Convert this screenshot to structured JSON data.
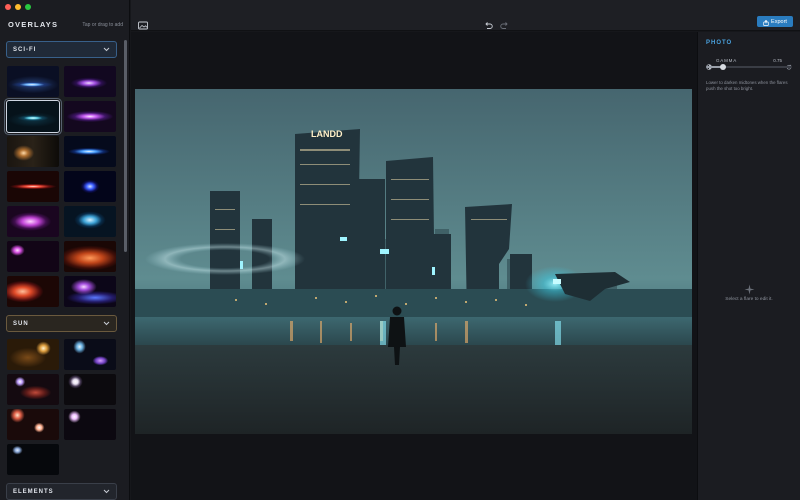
{
  "window": {
    "traffic_lights": [
      "#ff5f57",
      "#febc2e",
      "#28c840"
    ]
  },
  "sidebar": {
    "title": "OVERLAYS",
    "hint": "Tap or drag to add",
    "categories": [
      {
        "label": "SCI-FI",
        "expanded": true
      },
      {
        "label": "SUN",
        "expanded": true
      },
      {
        "label": "ELEMENTS",
        "expanded": false
      }
    ],
    "selected_thumbnail": "scifi-3"
  },
  "toolbar": {
    "image_icon": "image-icon",
    "undo_icon": "undo-icon",
    "redo_icon": "redo-icon",
    "export_label": "Export",
    "export_icon": "share-icon"
  },
  "photo": {
    "sign_text": "LANDD"
  },
  "panel": {
    "section_title": "PHOTO",
    "gamma_label": "GAMMA",
    "gamma_value": "0.75",
    "gamma_level": 0.2,
    "gamma_description": "Lower to darken midtones when the flares push the shot too bright.",
    "empty_state": "Select a flare to edit it."
  },
  "colors": {
    "accent": "#2a7cbf",
    "section_title": "#4aa3e0"
  }
}
